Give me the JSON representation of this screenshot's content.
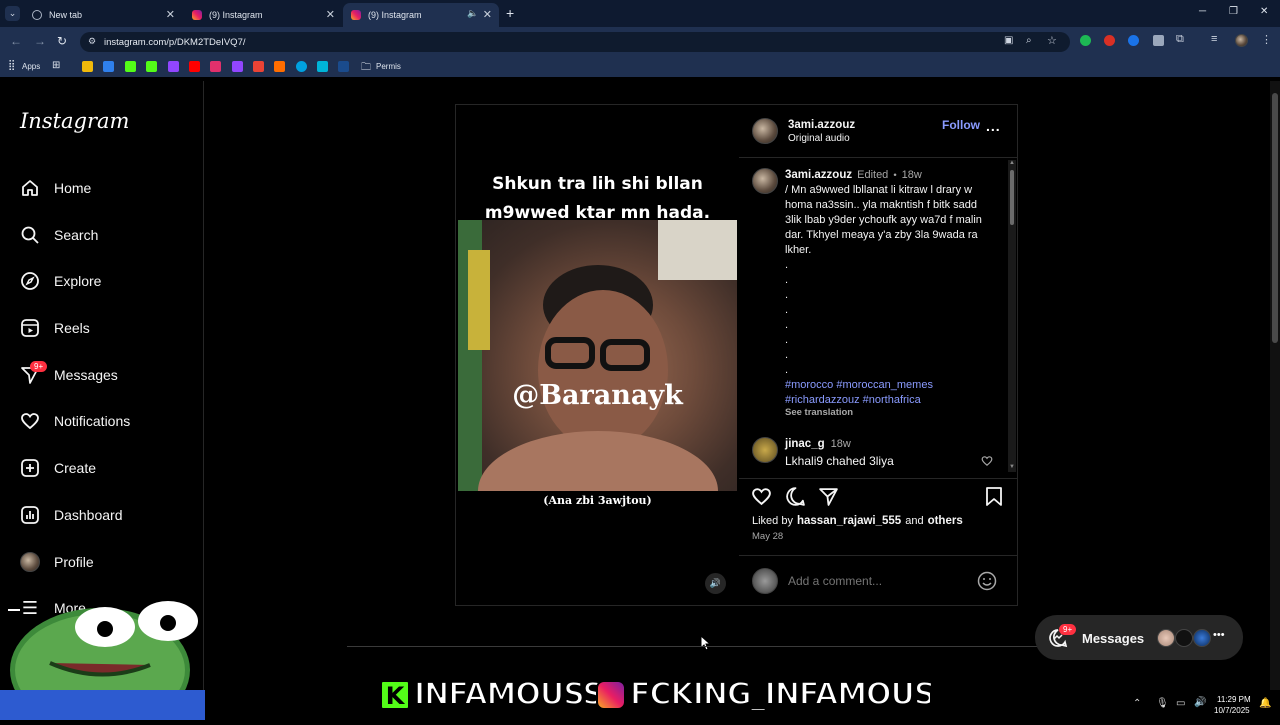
{
  "browser": {
    "tabs": [
      {
        "title": "New tab"
      },
      {
        "title": "(9) Instagram"
      },
      {
        "title": "(9) Instagram"
      }
    ],
    "url": "instagram.com/p/DKM2TDeIVQ7/",
    "bookmarks": {
      "apps_label": "Apps",
      "folder_label": "Permis"
    }
  },
  "instagram": {
    "logo": "Instagram",
    "nav": [
      {
        "label": "Home",
        "icon": "home-icon"
      },
      {
        "label": "Search",
        "icon": "search-icon"
      },
      {
        "label": "Explore",
        "icon": "compass-icon"
      },
      {
        "label": "Reels",
        "icon": "reels-icon"
      },
      {
        "label": "Messages",
        "icon": "messenger-icon",
        "badge": "9+"
      },
      {
        "label": "Notifications",
        "icon": "heart-icon"
      },
      {
        "label": "Create",
        "icon": "plus-square-icon"
      },
      {
        "label": "Dashboard",
        "icon": "chart-icon"
      },
      {
        "label": "Profile",
        "icon": "avatar"
      }
    ],
    "more_label": "More"
  },
  "post": {
    "media": {
      "caption_top_line1": "Shkun tra lih shi bllan",
      "caption_top_line2": "m9wwed ktar mn hada.",
      "watermark": "@Baranayk",
      "caption_bottom": "(Ana zbi 3awjtou)"
    },
    "header": {
      "username": "3ami.azzouz",
      "subtitle": "Original audio",
      "follow_label": "Follow",
      "more": "..."
    },
    "caption": {
      "username": "3ami.azzouz",
      "edited": "Edited",
      "dot": "•",
      "age": "18w",
      "text_lines": [
        "/ Mn a9wwed lbllanat li kitraw l drary w",
        "homa na3ssin.. yla makntish f bitk sadd",
        "3lik lbab y9der ychoufk ayy wa7d f malin",
        "dar. Tkhyel meaya y'a zby 3la 9wada ra",
        "lkher."
      ],
      "dots": [
        ".",
        ".",
        ".",
        ".",
        ".",
        ".",
        ".",
        "."
      ],
      "hashtags_line1": "#morocco #moroccan_memes",
      "hashtags_line2": "#richardazzouz #northafrica",
      "see_translation": "See translation"
    },
    "comment": {
      "username": "jinac_g",
      "age": "18w",
      "text": "Lkhali9 chahed 3liya"
    },
    "likes": {
      "prefix": "Liked by",
      "user": "hassan_rajawi_555",
      "and": "and",
      "others": "others",
      "date": "May 28"
    },
    "add_comment_placeholder": "Add a comment..."
  },
  "messages_bubble": {
    "label": "Messages",
    "badge": "9+"
  },
  "overlay": {
    "left_handle": "INFAMOUSS",
    "right_handle": "FCKING_INFAMOUS"
  },
  "taskbar": {
    "time": "11:29 PM",
    "date": "10/7/2025"
  },
  "colors": {
    "accent": "#0095f6",
    "follow": "#8a9bff",
    "badge": "#ff3040",
    "kick": "#53fc18"
  }
}
